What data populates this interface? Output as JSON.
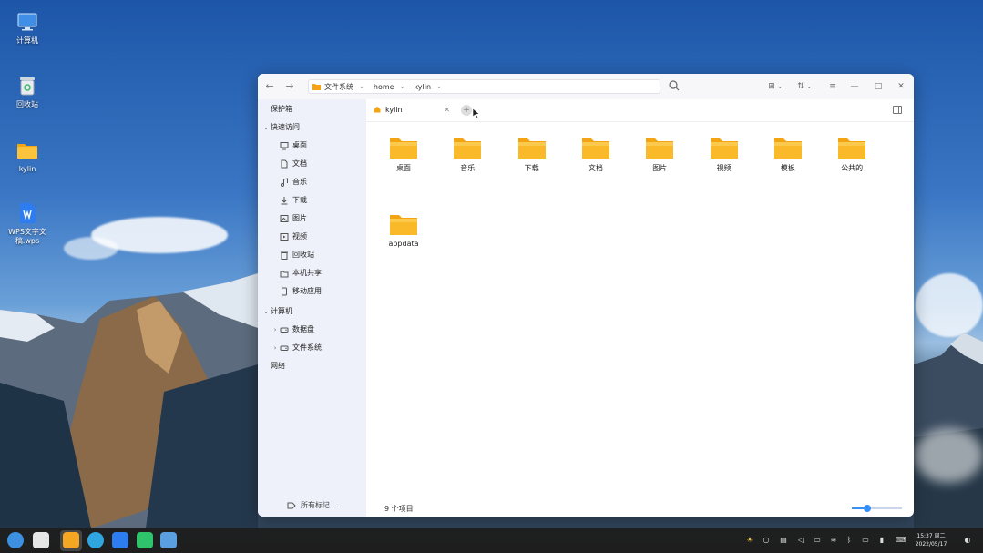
{
  "desktop": {
    "icons": [
      {
        "label": "计算机",
        "icon": "computer-icon"
      },
      {
        "label": "回收站",
        "icon": "trash-icon"
      },
      {
        "label": "kylin",
        "icon": "folder-icon"
      },
      {
        "label": "WPS文字文稿.wps",
        "icon": "wps-doc-icon"
      }
    ]
  },
  "window": {
    "path": {
      "crumbs": [
        "文件系统",
        "home",
        "kylin"
      ]
    },
    "toolbar": {
      "back": "←",
      "forward": "→",
      "view_mode": "⊞",
      "sort": "⇅",
      "menu": "≡",
      "minimize": "—",
      "maximize": "□",
      "close": "✕"
    },
    "sidebar": {
      "items": [
        {
          "label": "保护箱",
          "level": 0
        },
        {
          "label": "快速访问",
          "level": 0,
          "expander": "⌄"
        },
        {
          "label": "桌面",
          "level": 1,
          "icon": "desktop-icon"
        },
        {
          "label": "文档",
          "level": 1,
          "icon": "document-icon"
        },
        {
          "label": "音乐",
          "level": 1,
          "icon": "music-icon"
        },
        {
          "label": "下载",
          "level": 1,
          "icon": "download-icon"
        },
        {
          "label": "图片",
          "level": 1,
          "icon": "picture-icon"
        },
        {
          "label": "视频",
          "level": 1,
          "icon": "video-icon"
        },
        {
          "label": "回收站",
          "level": 1,
          "icon": "trash-icon"
        },
        {
          "label": "本机共享",
          "level": 1,
          "icon": "share-icon"
        },
        {
          "label": "移动应用",
          "level": 1,
          "icon": "mobile-app-icon"
        },
        {
          "label": "计算机",
          "level": 0,
          "expander": "⌄"
        },
        {
          "label": "数据盘",
          "level": 1,
          "expander": "›",
          "icon": "drive-icon"
        },
        {
          "label": "文件系统",
          "level": 1,
          "expander": "›",
          "icon": "drive-icon"
        },
        {
          "label": "网络",
          "level": 0
        }
      ],
      "footer": "所有标记..."
    },
    "tab": {
      "label": "kylin",
      "close": "✕",
      "add": "+"
    },
    "folders": [
      {
        "label": "桌面"
      },
      {
        "label": "音乐"
      },
      {
        "label": "下载"
      },
      {
        "label": "文档"
      },
      {
        "label": "图片"
      },
      {
        "label": "视频"
      },
      {
        "label": "模板"
      },
      {
        "label": "公共的"
      },
      {
        "label": "appdata"
      }
    ],
    "status": "9 个项目",
    "zoom_level": 0.3
  },
  "taskbar": {
    "apps": [
      {
        "name": "start-menu-icon",
        "color": "#3d8fe0"
      },
      {
        "name": "multitask-view-icon",
        "color": "#e6e6e6"
      },
      {
        "name": "file-manager-icon",
        "color": "#f5a623"
      },
      {
        "name": "browser-icon",
        "color": "#2fa6e0"
      },
      {
        "name": "wps-icon",
        "color": "#2d7cf0"
      },
      {
        "name": "software-store-icon",
        "color": "#2fc46b"
      },
      {
        "name": "image-viewer-icon",
        "color": "#5aa0e0"
      }
    ],
    "clock": {
      "time": "15:37 周二",
      "date": "2022/05/17"
    }
  },
  "colors": {
    "accent": "#3790fa",
    "folder_yellow": "#f9b928",
    "sidebar_bg": "#eef1f9"
  }
}
